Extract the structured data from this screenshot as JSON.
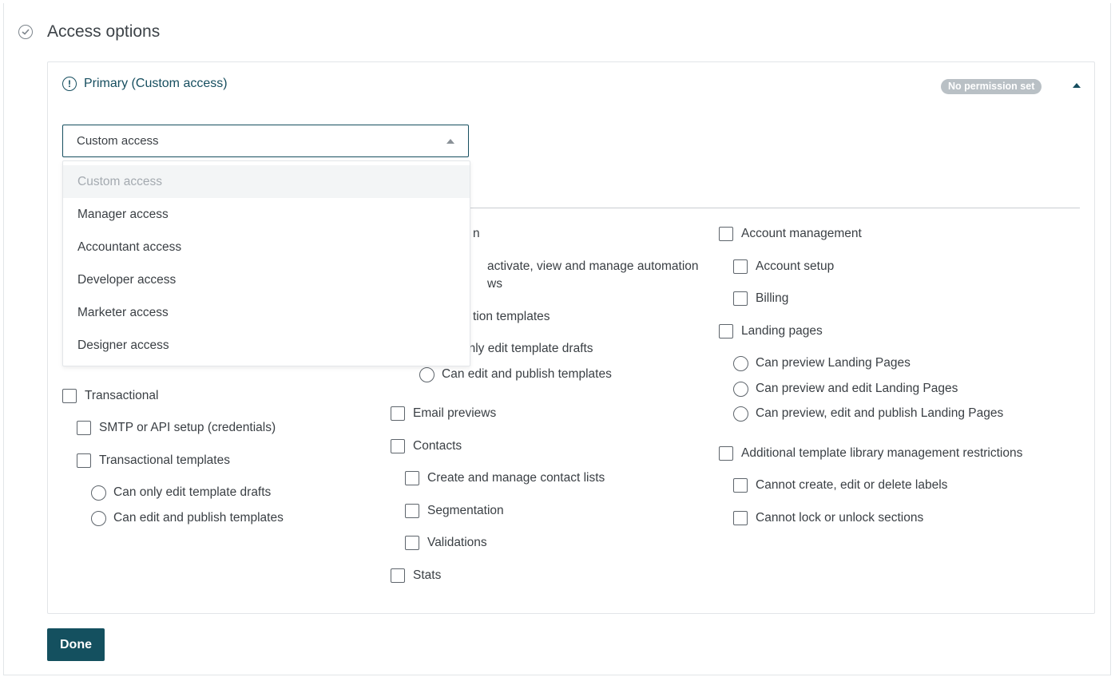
{
  "section": {
    "title": "Access options",
    "icon": "check-circle-icon"
  },
  "panel": {
    "title": "Primary (Custom access)",
    "icon": "alert-circle-icon",
    "badge": "No permission set"
  },
  "access_select": {
    "value": "Custom access",
    "options": [
      "Custom access",
      "Manager access",
      "Accountant access",
      "Developer access",
      "Marketer access",
      "Designer access"
    ]
  },
  "col1": {
    "transactional": "Transactional",
    "smtp": "SMTP or API setup (credentials)",
    "trans_templates": "Transactional templates",
    "drafts_only": "Can only edit template drafts",
    "edit_publish": "Can edit and publish templates"
  },
  "col2": {
    "automation_partial": "n",
    "automation_workflows_line1": "activate, view and manage automation",
    "automation_workflows_line2": "ws",
    "automation_templates": "tion templates",
    "drafts_only_partial": "only edit template drafts",
    "edit_publish": "Can edit and publish templates",
    "email_previews": "Email previews",
    "contacts": "Contacts",
    "contact_lists": "Create and manage contact lists",
    "segmentation": "Segmentation",
    "validations": "Validations",
    "stats": "Stats"
  },
  "col3": {
    "account_management": "Account management",
    "account_setup": "Account setup",
    "billing": "Billing",
    "landing_pages": "Landing pages",
    "lp_preview": "Can preview Landing Pages",
    "lp_preview_edit": "Can preview and edit Landing Pages",
    "lp_preview_edit_publish": "Can preview, edit and publish Landing Pages",
    "template_restrictions": "Additional template library management restrictions",
    "no_labels": "Cannot create, edit or delete labels",
    "no_lock": "Cannot lock or unlock sections"
  },
  "done_label": "Done",
  "colors": {
    "accent": "#14505f",
    "badge": "#b9c0c5"
  }
}
